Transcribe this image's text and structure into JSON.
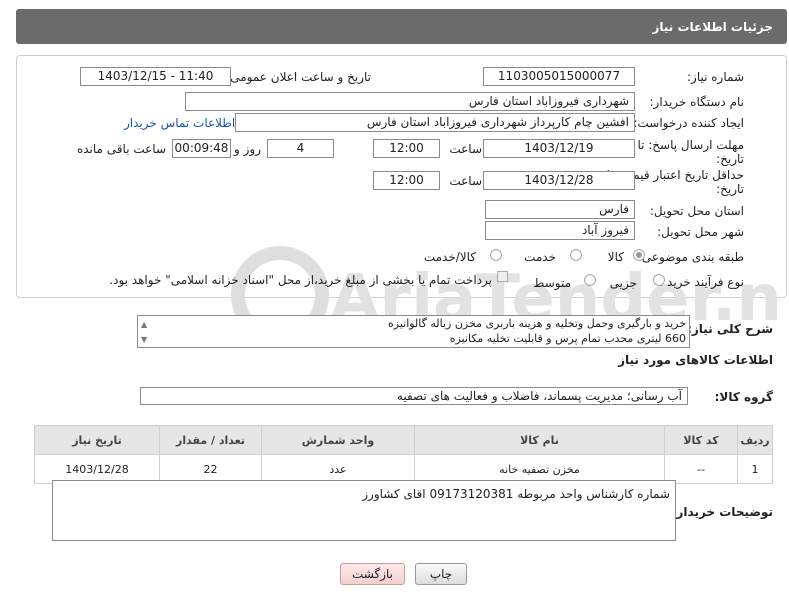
{
  "header": {
    "title": "جزئیات اطلاعات نیاز"
  },
  "need_number": {
    "label": "شماره نیاز:",
    "value": "1103005015000077"
  },
  "announce": {
    "label": "تاریخ و ساعت اعلان عمومی:",
    "value": "1403/12/15 - 11:40"
  },
  "buyer_org": {
    "label": "نام دستگاه خریدار:",
    "value": "شهرداری فیروزاباد استان فارس"
  },
  "requester": {
    "label": "ایجاد کننده درخواست:",
    "value": "افشین چام کارپرداز شهرداری فیروزاباد استان فارس",
    "contact_link": "اطلاعات تماس خریدار"
  },
  "deadline": {
    "label_line1": "مهلت ارسال پاسخ: تا",
    "label_line2": "تاریخ:",
    "date": "1403/12/19",
    "time_label": "ساعت",
    "time": "12:00",
    "days": "4",
    "days_label": "روز و",
    "remaining": "00:09:48",
    "remaining_label": "ساعت باقی مانده"
  },
  "validity": {
    "label_line1": "حداقل تاریخ اعتبار قیمت: تا",
    "label_line2": "تاریخ:",
    "date": "1403/12/28",
    "time_label": "ساعت",
    "time": "12:00"
  },
  "province": {
    "label": "استان محل تحویل:",
    "value": "فارس"
  },
  "city": {
    "label": "شهر محل تحویل:",
    "value": "فیروز آباد"
  },
  "category": {
    "label": "طبقه بندی موضوعی:",
    "options": [
      "کالا",
      "خدمت",
      "کالا/خدمت"
    ],
    "selected": "کالا"
  },
  "purchase_type": {
    "label": "نوع فرآیند خرید :",
    "options": [
      "جزیی",
      "متوسط"
    ],
    "selected": "",
    "note": "پرداخت تمام یا بخشی از مبلغ خرید،از محل \"اسناد خزانه اسلامی\" خواهد بود."
  },
  "description": {
    "label": "شرح کلی نیاز:",
    "line1": "خرید و بارگیری وحمل وتخلیه  و هزینه باربری مخزن زباله گالوانیزه",
    "line2": "660 لیتری محدب تمام پرس و قابلیت تخلیه مکانیزه"
  },
  "goods_info": {
    "title": "اطلاعات کالاهای مورد نیاز"
  },
  "goods_group": {
    "label": "گروه کالا:",
    "value": "آب رسانی؛ مدیریت پسماند، فاضلاب و فعالیت های تصفیه"
  },
  "table": {
    "headers": [
      "ردیف",
      "کد کالا",
      "نام کالا",
      "واحد شمارش",
      "تعداد / مقدار",
      "تاریخ نیاز"
    ],
    "rows": [
      [
        "1",
        "--",
        "مخزن تصفیه خانه",
        "عدد",
        "22",
        "1403/12/28"
      ]
    ]
  },
  "buyer_notes": {
    "label": "توضیحات خریدار:",
    "value": "شماره کارشناس واحد مربوطه 09173120381 اقای کشاورز"
  },
  "buttons": {
    "print": "چاپ",
    "back": "بازگشت"
  },
  "watermark": "AriaTender.neT"
}
